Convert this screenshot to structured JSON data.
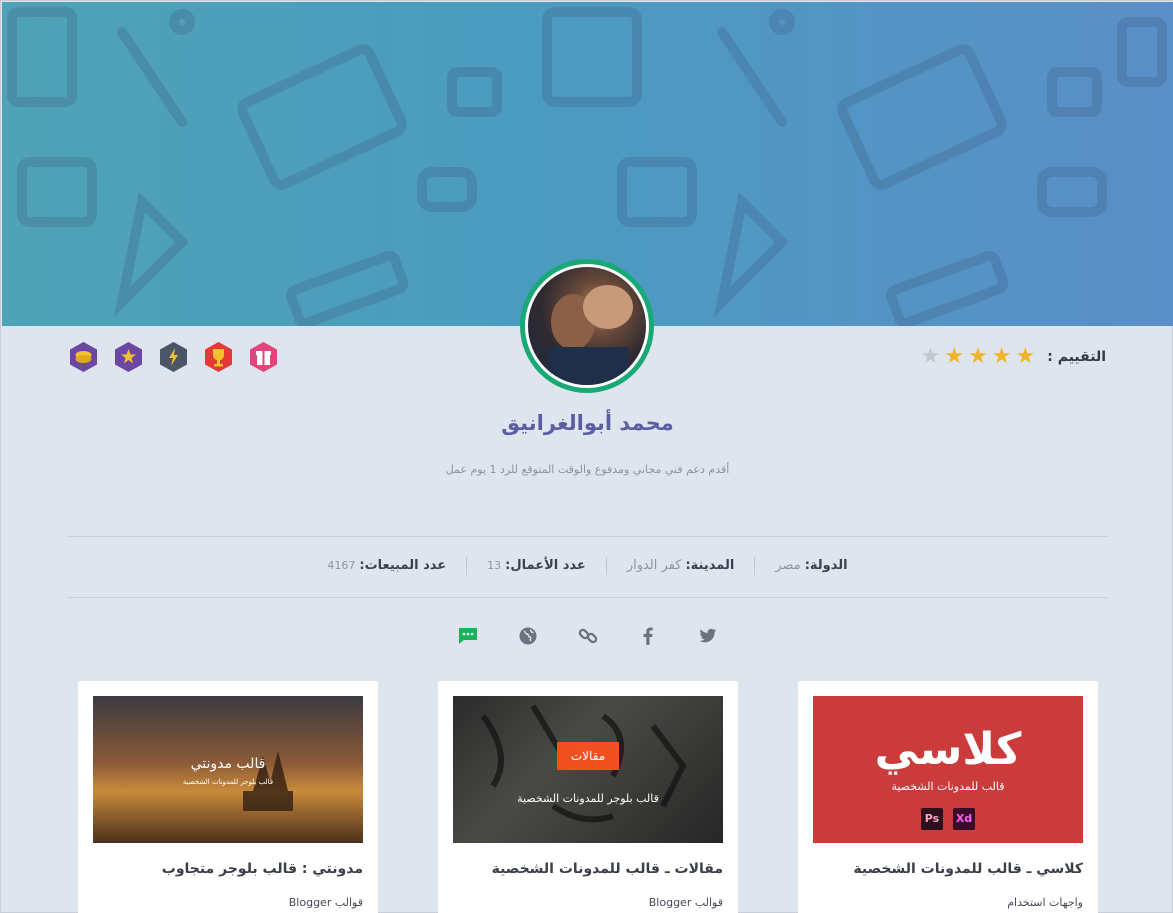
{
  "profile": {
    "name": "محمد أبوالغرانيق",
    "bio": "أقدم دعم فني مجاني ومدفوع والوقت المتوقع للرد 1 يوم عمل",
    "rating_label": "التقييم :",
    "rating_value": 4,
    "rating_max": 5
  },
  "badges": [
    {
      "name": "gift-badge-icon",
      "color": "#e0457b"
    },
    {
      "name": "trophy-badge-icon",
      "color": "#e53935"
    },
    {
      "name": "lightning-badge-icon",
      "color": "#4a5568"
    },
    {
      "name": "star-badge-icon",
      "color": "#6b46a3"
    },
    {
      "name": "coins-badge-icon",
      "color": "#6b46a3"
    }
  ],
  "stats": [
    {
      "label": "الدولة:",
      "value": "مصر"
    },
    {
      "label": "المدينة:",
      "value": "كفر الدوار"
    },
    {
      "label": "عدد الأعمال:",
      "value": "13"
    },
    {
      "label": "عدد المبيعات:",
      "value": "4167"
    }
  ],
  "socials": [
    {
      "name": "twitter-icon"
    },
    {
      "name": "facebook-icon"
    },
    {
      "name": "link-icon"
    },
    {
      "name": "website-icon"
    },
    {
      "name": "chat-icon",
      "color": "#19b35a"
    }
  ],
  "cards": [
    {
      "title": "كلاسي ـ قالب للمدونات الشخصية",
      "category": "واجهات استخدام",
      "thumb_heading": "كلاسي",
      "thumb_sub": "قالب للمدونات الشخصية",
      "thumb_tag1": "Ps",
      "thumb_tag2": "Xd"
    },
    {
      "title": "مقالات ـ قالب للمدونات الشخصية",
      "category": "قوالب Blogger",
      "thumb_badge": "مقالات",
      "thumb_sub": "قالب بلوجر للمدونات الشخصية"
    },
    {
      "title": "مدونتي : قالب بلوجر متجاوب",
      "category": "قوالب Blogger",
      "thumb_heading": "قالب مدونتي",
      "thumb_sub": "قالب بلوجر للمدونات الشخصية"
    }
  ]
}
